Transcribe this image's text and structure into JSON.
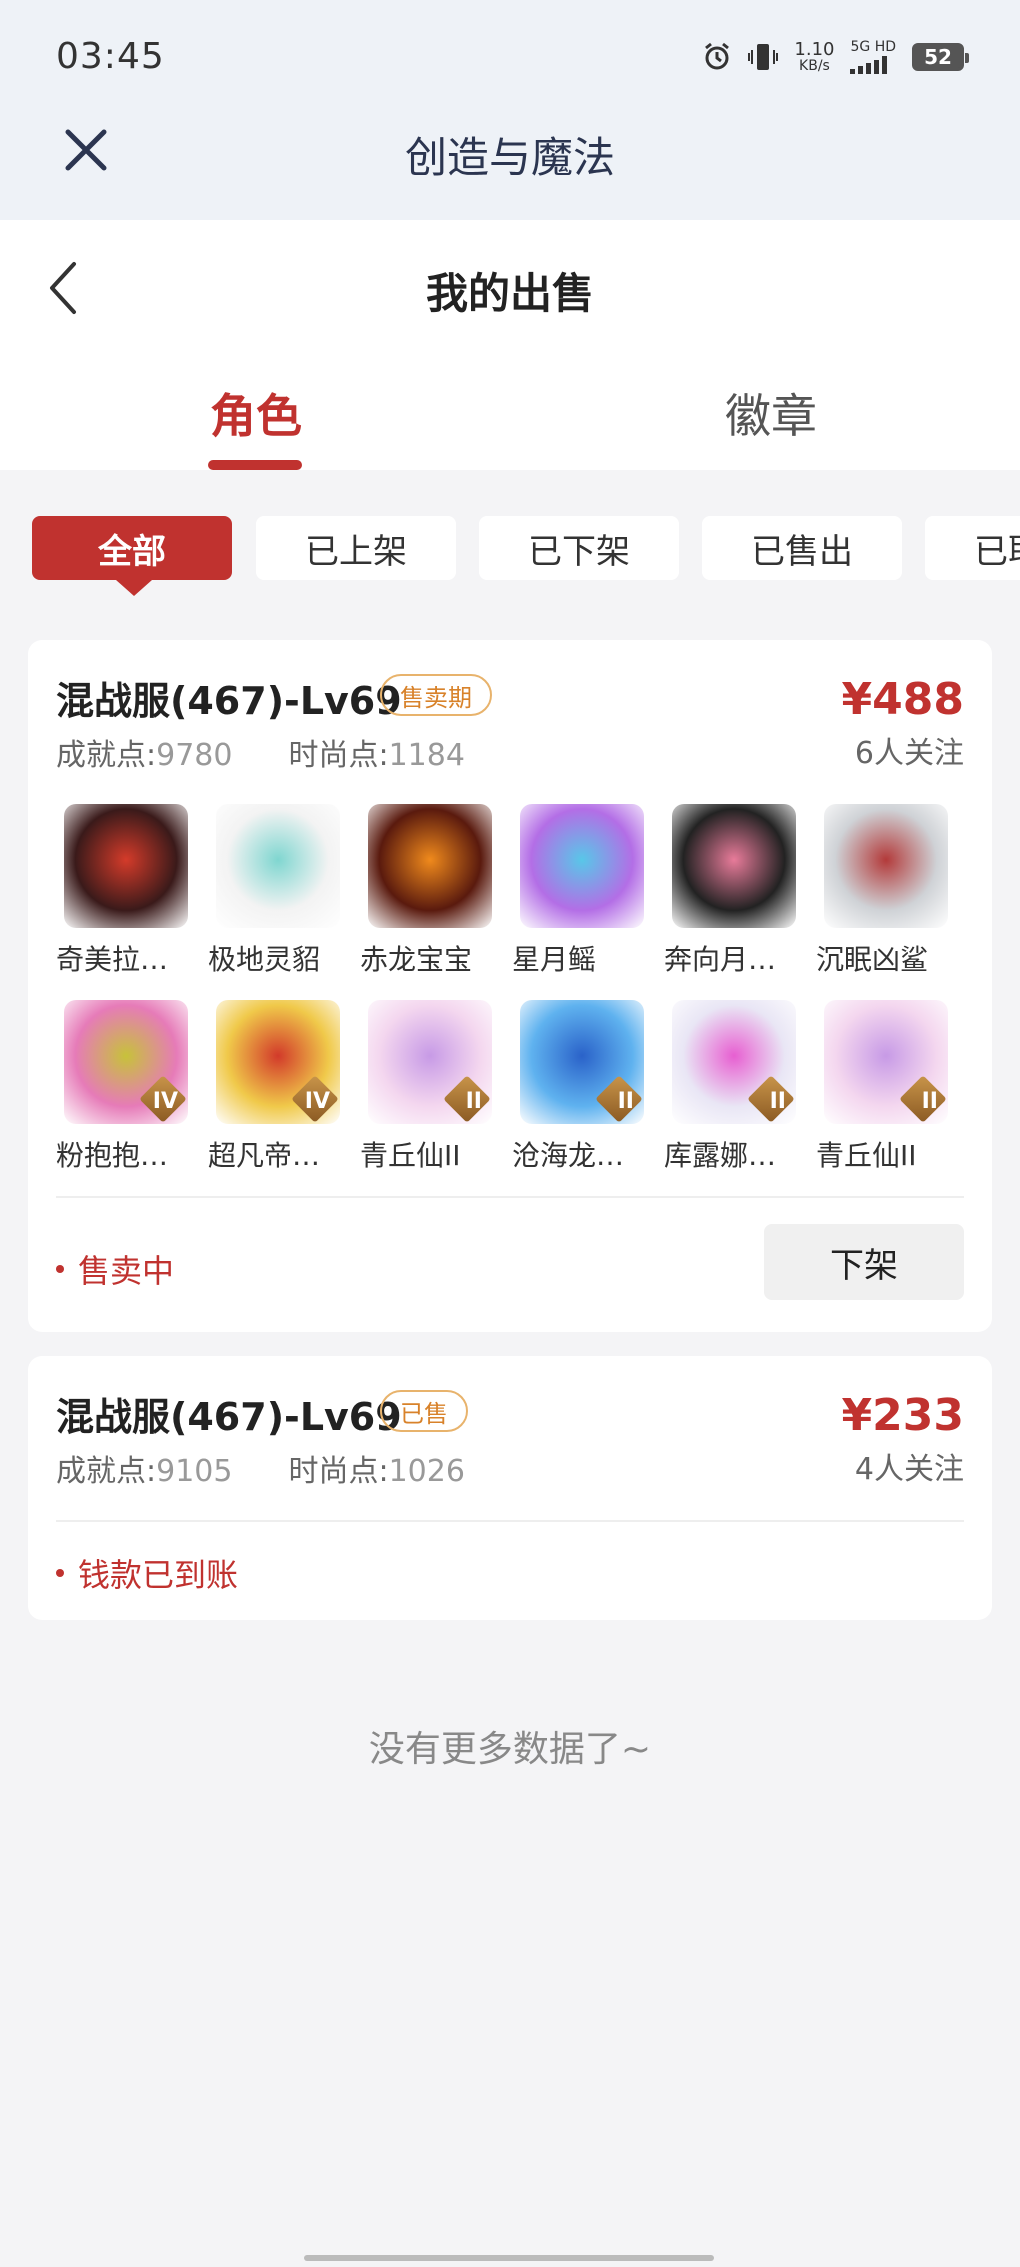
{
  "status_bar": {
    "time": "03:45",
    "speed_value": "1.10",
    "speed_unit": "KB/s",
    "network_label": "5G HD",
    "battery": "52",
    "icons": [
      "alarm-icon",
      "vibrate-icon",
      "signal-icon",
      "battery-icon"
    ]
  },
  "app_header": {
    "close_icon": "close-icon",
    "title": "创造与魔法"
  },
  "page_header": {
    "back_icon": "chevron-left-icon",
    "title": "我的出售"
  },
  "tabs": [
    {
      "label": "角色",
      "active": true
    },
    {
      "label": "徽章",
      "active": false
    }
  ],
  "filters": [
    {
      "label": "全部",
      "active": true
    },
    {
      "label": "已上架",
      "active": false
    },
    {
      "label": "已下架",
      "active": false
    },
    {
      "label": "已售出",
      "active": false
    },
    {
      "label": "已取消",
      "active": false
    }
  ],
  "listings": [
    {
      "title": "混战服(467)-Lv69",
      "tag": "售卖期",
      "price": "¥488",
      "followers": "6人关注",
      "achievement_label": "成就点:",
      "achievement_value": "9780",
      "fashion_label": "时尚点:",
      "fashion_value": "1184",
      "pets": [
        {
          "name": "奇美拉…",
          "color": "#3a1a1a",
          "accent": "#d43b2a"
        },
        {
          "name": "极地灵貂",
          "color": "#f3f3f3",
          "accent": "#7fd6d0"
        },
        {
          "name": "赤龙宝宝",
          "color": "#5a1a0e",
          "accent": "#f08a1c"
        },
        {
          "name": "星月鳐",
          "color": "#b36ee6",
          "accent": "#58c7e8"
        },
        {
          "name": "奔向月…",
          "color": "#222222",
          "accent": "#e87b9a"
        },
        {
          "name": "沉眠凶鲨",
          "color": "#cfd2d6",
          "accent": "#b33a3a"
        },
        {
          "name": "粉抱抱…",
          "color": "#e67bb8",
          "accent": "#c7c23a",
          "rank": "IV"
        },
        {
          "name": "超凡帝…",
          "color": "#f0c94a",
          "accent": "#d23a2a",
          "rank": "IV"
        },
        {
          "name": "青丘仙II",
          "color": "#f4d7ef",
          "accent": "#c79ae6",
          "rank": "II"
        },
        {
          "name": "沧海龙…",
          "color": "#5fb2ef",
          "accent": "#2a62c9",
          "rank": "II"
        },
        {
          "name": "库露娜…",
          "color": "#e9e6f5",
          "accent": "#e75fd1",
          "rank": "II"
        },
        {
          "name": "青丘仙II",
          "color": "#f4d7ef",
          "accent": "#c79ae6",
          "rank": "II"
        }
      ],
      "state": "售卖中",
      "action": "下架"
    },
    {
      "title": "混战服(467)-Lv69",
      "tag": "已售",
      "price": "¥233",
      "followers": "4人关注",
      "achievement_label": "成就点:",
      "achievement_value": "9105",
      "fashion_label": "时尚点:",
      "fashion_value": "1026",
      "state": "钱款已到账"
    }
  ],
  "footer": {
    "no_more": "没有更多数据了~"
  },
  "colors": {
    "accent": "#c0322f",
    "tag_orange": "#d8822a",
    "header_bg": "#eef2f7"
  }
}
